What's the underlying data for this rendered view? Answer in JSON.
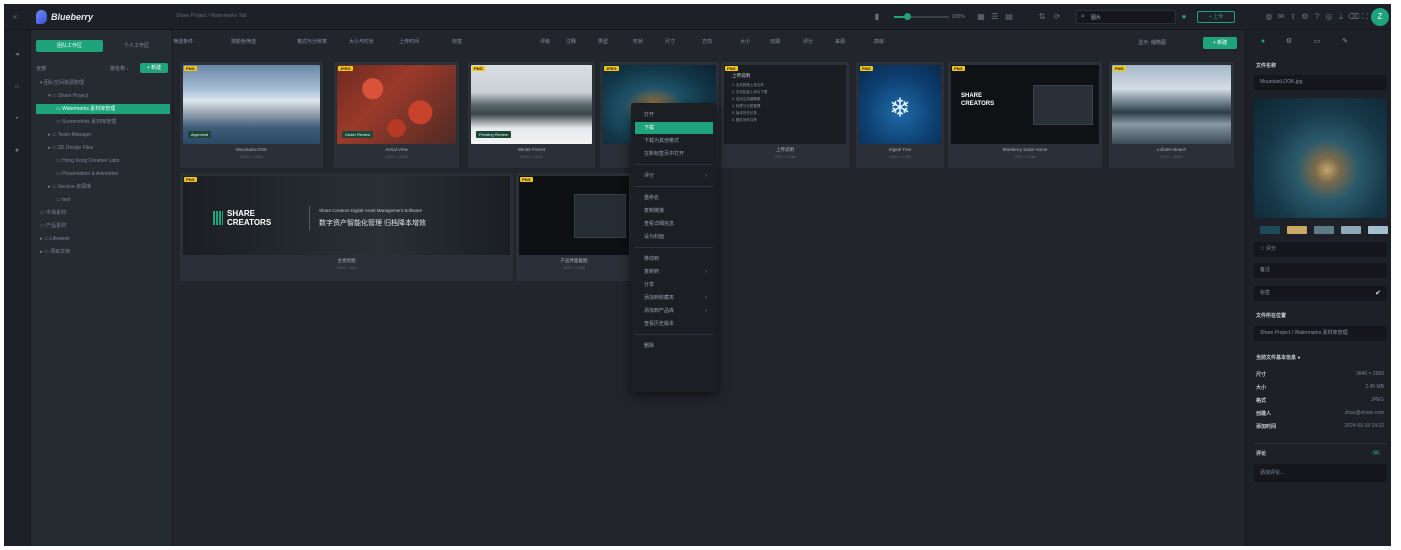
{
  "topbar": {
    "app_name": "Blueberry",
    "breadcrumb": "Share Project / Watermarks Tab",
    "zoom_level": "200%",
    "zoom_fraction": 0.22,
    "search_value": "图片",
    "green_button": "+ 上传"
  },
  "avatar": {
    "initial": "Z"
  },
  "workspace_tabs": [
    "团队工作区",
    "个人工作区"
  ],
  "folder_panel": {
    "label": "全部",
    "sort_label": "按名称 ↓",
    "new_button": "+ 新建",
    "items": [
      {
        "label": "▾ 团队空间资源管理",
        "indent": 0,
        "selected": false
      },
      {
        "label": "▾ ▭ Share Project",
        "indent": 1,
        "selected": false
      },
      {
        "label": "▭ Watermarks 素材库管理",
        "indent": 2,
        "selected": true
      },
      {
        "label": "▭ Screenshots 素材库管理",
        "indent": 2,
        "selected": false
      },
      {
        "label": "▸ ▭ Team Manager",
        "indent": 1,
        "selected": false
      },
      {
        "label": "▸ ▭ 3D Design Files",
        "indent": 1,
        "selected": false
      },
      {
        "label": "▭ Hong Kong Creative Labs",
        "indent": 2,
        "selected": false
      },
      {
        "label": "▭ Presentation & Animation",
        "indent": 2,
        "selected": false
      },
      {
        "label": "▸ ▭ Service 资源库",
        "indent": 1,
        "selected": false
      },
      {
        "label": "▭ test",
        "indent": 2,
        "selected": false
      },
      {
        "label": "▭ 市场素材",
        "indent": 0,
        "selected": false
      },
      {
        "label": "▭ 产品素材",
        "indent": 0,
        "selected": false
      },
      {
        "label": "▸ ▭ Lifeweek",
        "indent": 0,
        "selected": false
      },
      {
        "label": "▸ ▭ 项目文档",
        "indent": 0,
        "selected": false
      }
    ]
  },
  "toolbar": {
    "filters": [
      "筛选条件",
      "按颜色筛选",
      "格式与分辨率",
      "大小与时长",
      "上传时间",
      "标签",
      "评级",
      "注释",
      "类型",
      "形状",
      "尺寸",
      "方向",
      "大小",
      "日期",
      "评分",
      "来源",
      "高级"
    ],
    "secondary_label": "显示: 缩略图",
    "primary_button": "+ 新建"
  },
  "assets": [
    {
      "badge": "PNG",
      "name": "MountainLOOK",
      "meta": "3840 × 2560",
      "tag": "Approved"
    },
    {
      "badge": "JPEG",
      "name": "Aerial View",
      "meta": "4000 × 3000",
      "tag": "Under Review"
    },
    {
      "badge": "PNG",
      "name": "Winter Forest",
      "meta": "2048 × 1365",
      "tag": "Pending Review"
    },
    {
      "badge": "JPEG",
      "name": "Coast Aerial",
      "meta": "3024 × 4032",
      "tag": ""
    },
    {
      "badge": "PNG",
      "name": "上传说明",
      "meta": "1920 × 1080",
      "tag": ""
    },
    {
      "badge": "PNG",
      "name": "Digital Tree",
      "meta": "1080 × 1350",
      "tag": ""
    },
    {
      "badge": "PNG",
      "name": "Blueberry SaaS Home",
      "meta": "1920 × 1080",
      "tag": ""
    },
    {
      "badge": "PNG",
      "name": "Lofoten Beach",
      "meta": "5472 × 3648",
      "tag": ""
    },
    {
      "badge": "PNG",
      "name": "主视觉图",
      "meta": "1920 × 640",
      "tag": ""
    },
    {
      "badge": "PNG",
      "name": "产品界面截图",
      "meta": "1920 × 1080",
      "tag": ""
    }
  ],
  "banner": {
    "brand_line_1": "SHARE",
    "brand_line_2": "CREATORS",
    "subtitle_en": "Share Creators Digital Asset Management Software",
    "subtitle_cn": "数字资产智能化管理  归档降本增效"
  },
  "dark_card": {
    "title_line": "上传说明",
    "lines": [
      "1. 支持拖拽上传文件",
      "2. 支持批量上传与下载",
      "3. 自动生成缩略图",
      "4. 标签与分类管理",
      "5. 版本历史记录",
      "6. 团队协作共享"
    ]
  },
  "context_menu": {
    "items": [
      {
        "label": "打开",
        "highlight": false,
        "submenu": false
      },
      {
        "label": "下载",
        "highlight": true,
        "submenu": false
      },
      {
        "label": "下载为其他格式",
        "highlight": false,
        "submenu": false
      },
      {
        "label": "在新标签页中打开",
        "highlight": false,
        "submenu": false
      },
      {
        "label": "评分",
        "highlight": false,
        "submenu": true
      },
      {
        "label": "重命名",
        "highlight": false,
        "submenu": false
      },
      {
        "label": "复制链接",
        "highlight": false,
        "submenu": false
      },
      {
        "label": "查看详细信息",
        "highlight": false,
        "submenu": false
      },
      {
        "label": "设为封面",
        "highlight": false,
        "submenu": false
      },
      {
        "label": "移动到",
        "highlight": false,
        "submenu": false
      },
      {
        "label": "复制到",
        "highlight": false,
        "submenu": true
      },
      {
        "label": "分享",
        "highlight": false,
        "submenu": false
      },
      {
        "label": "添加到收藏夹",
        "highlight": false,
        "submenu": true
      },
      {
        "label": "添加到产品库",
        "highlight": false,
        "submenu": true
      },
      {
        "label": "查看历史版本",
        "highlight": false,
        "submenu": false
      },
      {
        "label": "删除",
        "highlight": false,
        "submenu": false
      }
    ]
  },
  "right_panel": {
    "section_file_name": "文件名称",
    "file_name": "MountainLOOK.jpg",
    "swatches": [
      "#1f4a5c",
      "#c9a86a",
      "#5d7b86",
      "#8fa9b6",
      "#a7bfcc"
    ],
    "rating": "☆ 评分",
    "description_placeholder": "备注",
    "tags_placeholder": "标签",
    "section_location": "文件所在位置",
    "location": "Share Project / Watermarks 素材库管理",
    "section_info": "当前文件基本信息",
    "info": [
      {
        "k": "尺寸",
        "v": "3840 × 2560"
      },
      {
        "k": "大小",
        "v": "2.45 MB"
      },
      {
        "k": "格式",
        "v": "JPEG"
      },
      {
        "k": "创建人",
        "v": "zhao@share.com"
      },
      {
        "k": "添加时间",
        "v": "2024-09-18 14:22"
      }
    ],
    "section_comment": "评论",
    "comment_count": "0",
    "comment_placeholder": "添加评论..."
  },
  "colors": {
    "accent": "#1fa37a",
    "badge": "#f5c518",
    "background": "#22252c"
  }
}
